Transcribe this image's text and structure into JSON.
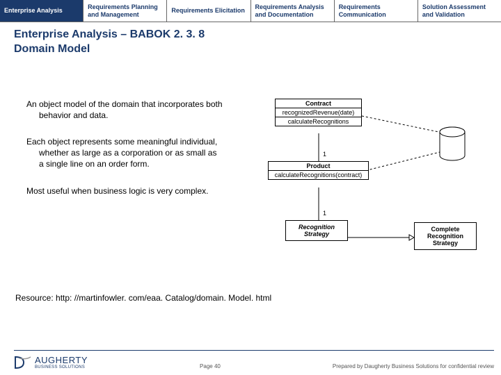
{
  "tabs": [
    {
      "label": "Enterprise Analysis"
    },
    {
      "label": "Requirements Planning and Management"
    },
    {
      "label": "Requirements Elicitation"
    },
    {
      "label": "Requirements Analysis and Documentation"
    },
    {
      "label": "Requirements Communication"
    },
    {
      "label": "Solution Assessment and Validation"
    }
  ],
  "title_line1": "Enterprise Analysis – BABOK 2. 3. 8",
  "title_line2": "Domain Model",
  "paragraphs": [
    "An object model of the domain that incorporates both behavior and data.",
    "Each object represents some meaningful individual, whether as large as a corporation or as small as a single line on an order form.",
    "Most useful when business logic is very complex."
  ],
  "resource": "Resource: http: //martinfowler. com/eaa. Catalog/domain. Model. html",
  "diagram": {
    "contract": {
      "name": "Contract",
      "methods": [
        "recognizedRevenue(date)",
        "calculateRecognitions"
      ]
    },
    "product": {
      "name": "Product",
      "methods": [
        "calculateRecognitions(contract)"
      ]
    },
    "recognition": {
      "name": "Recognition Strategy"
    },
    "complete": {
      "name": "Complete Recognition Strategy"
    },
    "mult1": "1",
    "mult2": "1"
  },
  "footer": {
    "logo_name": "AUGHERTY",
    "logo_sub": "BUSINESS SOLUTIONS",
    "page": "Page 40",
    "right": "Prepared by Daugherty Business Solutions for confidential review"
  }
}
